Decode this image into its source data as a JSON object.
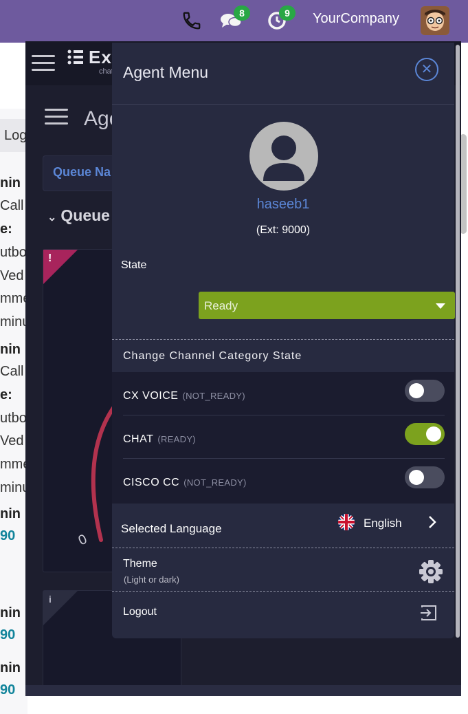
{
  "topbar": {
    "company": "YourCompany",
    "messages_badge": "8",
    "activity_badge": "9",
    "icons": [
      "phone-icon",
      "chat-bubbles-icon",
      "clock-check-icon",
      "user-avatar"
    ]
  },
  "background": {
    "log_tab": "Log",
    "rows": [
      {
        "text": "nin",
        "style": "bold"
      },
      {
        "text": "Call",
        "style": "normal"
      },
      {
        "text": "e:",
        "style": "bold"
      },
      {
        "text": "utbo",
        "style": "normal"
      },
      {
        "text": "Ved",
        "style": "normal"
      },
      {
        "text": "mme",
        "style": "normal"
      },
      {
        "text": "minu",
        "style": "normal"
      },
      {
        "text": "nin",
        "style": "bold"
      },
      {
        "text": "Call",
        "style": "normal"
      },
      {
        "text": "e:",
        "style": "bold"
      },
      {
        "text": "utbo",
        "style": "normal"
      },
      {
        "text": "Ved",
        "style": "normal"
      },
      {
        "text": "mme",
        "style": "normal"
      },
      {
        "text": "minu",
        "style": "normal"
      },
      {
        "text": "nin",
        "style": "bold"
      },
      {
        "text": "90",
        "style": "teal"
      },
      {
        "text": "nin",
        "style": "bold"
      },
      {
        "text": "90",
        "style": "teal"
      },
      {
        "text": "nin",
        "style": "bold"
      },
      {
        "text": "90",
        "style": "teal"
      }
    ]
  },
  "dashboard": {
    "logo": "Exp",
    "logo_sub": "chat",
    "title": "Agen",
    "queue_name": "Queue Na",
    "queue_heading": "Queue",
    "card_alert_mark": "!",
    "card_info_mark": "i",
    "gauge_zero": "0"
  },
  "menu": {
    "title": "Agent Menu",
    "username": "haseeb1",
    "extension": "(Ext: 9000)",
    "state_label": "State",
    "state_value": "Ready",
    "category_title": "Change Channel Category State",
    "channels": [
      {
        "name": "CX VOICE",
        "status": "(NOT_READY)",
        "enabled": false
      },
      {
        "name": "CHAT",
        "status": "(READY)",
        "enabled": true
      },
      {
        "name": "CISCO CC",
        "status": "(NOT_READY)",
        "enabled": false
      }
    ],
    "language_label": "Selected Language",
    "language_value": "English",
    "theme_label": "Theme",
    "theme_sub": "(Light or dark)",
    "logout_label": "Logout"
  },
  "colors": {
    "topbar": "#6e5a9e",
    "menu_bg": "#272a40",
    "accent_blue": "#5b86d6",
    "ready_green": "#7ca21e",
    "badge_green": "#28a745"
  }
}
